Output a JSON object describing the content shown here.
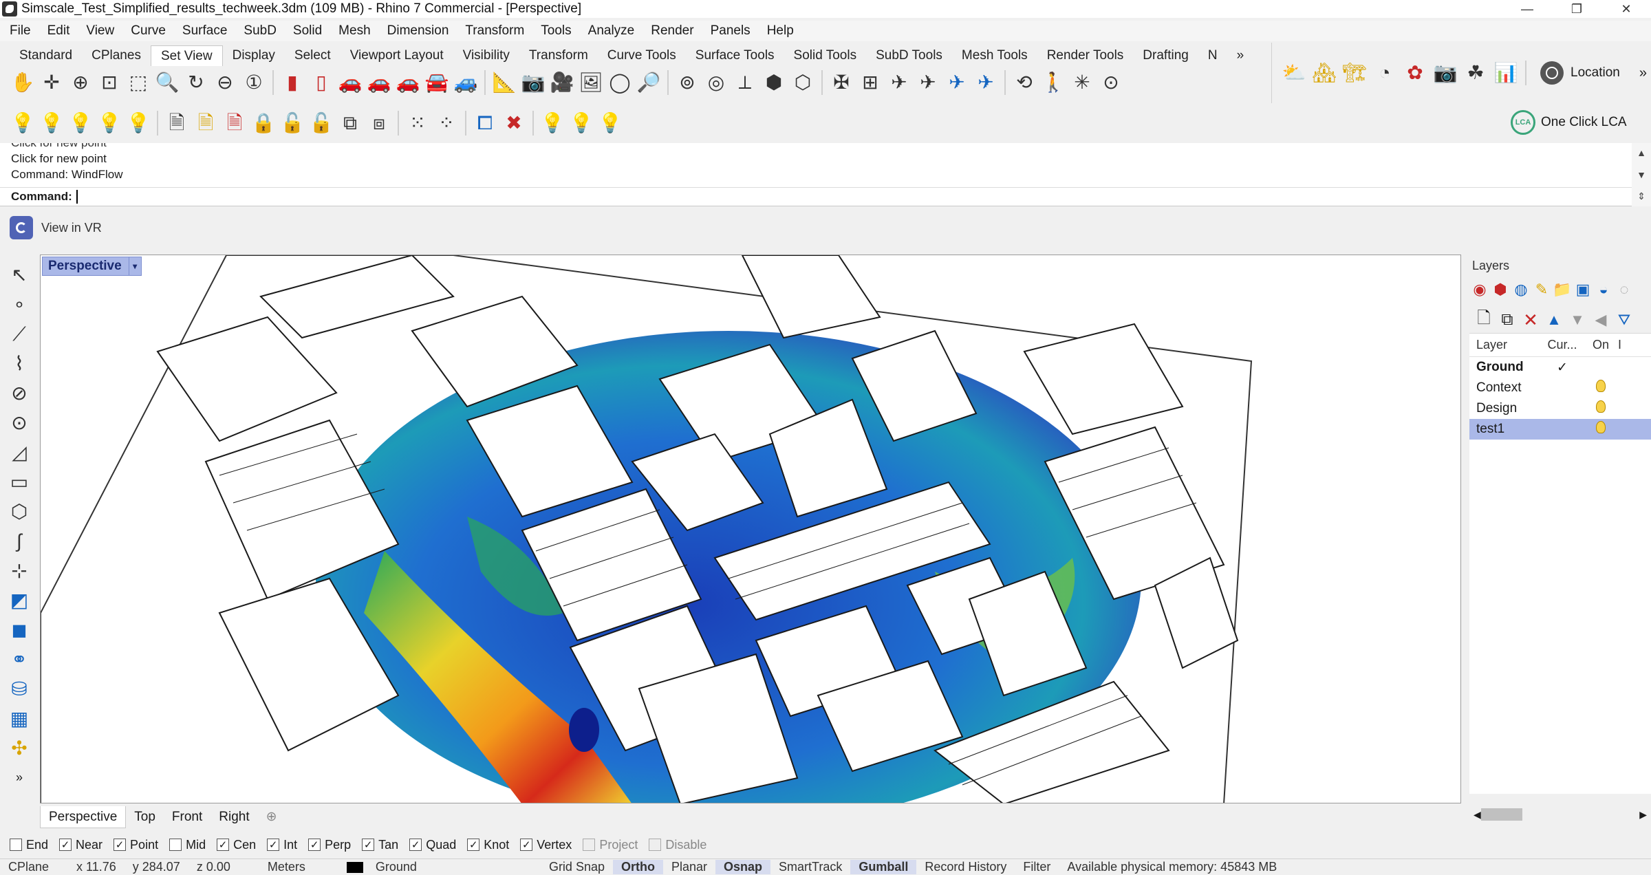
{
  "window": {
    "title": "Simscale_Test_Simplified_results_techweek.3dm (109 MB) - Rhino 7 Commercial - [Perspective]",
    "minimize": "—",
    "restore": "❐",
    "close": "✕"
  },
  "menu": [
    "File",
    "Edit",
    "View",
    "Curve",
    "Surface",
    "SubD",
    "Solid",
    "Mesh",
    "Dimension",
    "Transform",
    "Tools",
    "Analyze",
    "Render",
    "Panels",
    "Help"
  ],
  "tabs": {
    "items": [
      "Standard",
      "CPlanes",
      "Set View",
      "Display",
      "Select",
      "Viewport Layout",
      "Visibility",
      "Transform",
      "Curve Tools",
      "Surface Tools",
      "Solid Tools",
      "SubD Tools",
      "Mesh Tools",
      "Render Tools",
      "Drafting",
      "N"
    ],
    "active": "Set View",
    "overflow": "»"
  },
  "right_toolbar": {
    "location_label": "Location",
    "lca_label": "One Click LCA",
    "lca_badge": "LCA"
  },
  "command": {
    "history": [
      "Click for new point",
      "Click for new point",
      "Command: WindFlow"
    ],
    "prompt": "Command:",
    "input": ""
  },
  "vr": {
    "label": "View in VR"
  },
  "viewport": {
    "name": "Perspective",
    "tabs": [
      "Perspective",
      "Top",
      "Front",
      "Right"
    ],
    "active_tab": "Perspective",
    "add_tab": "⊕"
  },
  "layers": {
    "title": "Layers",
    "columns": [
      "Layer",
      "Cur...",
      "On",
      "I"
    ],
    "rows": [
      {
        "name": "Ground",
        "current": "✓",
        "on": false,
        "bold": true,
        "selected": false
      },
      {
        "name": "Context",
        "current": "",
        "on": true,
        "bold": false,
        "selected": false
      },
      {
        "name": "Design",
        "current": "",
        "on": true,
        "bold": false,
        "selected": false
      },
      {
        "name": "test1",
        "current": "",
        "on": true,
        "bold": false,
        "selected": true
      }
    ]
  },
  "osnap": [
    {
      "label": "End",
      "checked": false,
      "enabled": true
    },
    {
      "label": "Near",
      "checked": true,
      "enabled": true
    },
    {
      "label": "Point",
      "checked": true,
      "enabled": true
    },
    {
      "label": "Mid",
      "checked": false,
      "enabled": true
    },
    {
      "label": "Cen",
      "checked": true,
      "enabled": true
    },
    {
      "label": "Int",
      "checked": true,
      "enabled": true
    },
    {
      "label": "Perp",
      "checked": true,
      "enabled": true
    },
    {
      "label": "Tan",
      "checked": true,
      "enabled": true
    },
    {
      "label": "Quad",
      "checked": true,
      "enabled": true
    },
    {
      "label": "Knot",
      "checked": true,
      "enabled": true
    },
    {
      "label": "Vertex",
      "checked": true,
      "enabled": true
    },
    {
      "label": "Project",
      "checked": false,
      "enabled": false
    },
    {
      "label": "Disable",
      "checked": false,
      "enabled": false
    }
  ],
  "status": {
    "cplane": "CPlane",
    "x": "x 11.76",
    "y": "y 284.07",
    "z": "z 0.00",
    "units": "Meters",
    "layer": "Ground",
    "grid_snap": "Grid Snap",
    "ortho": "Ortho",
    "planar": "Planar",
    "osnap": "Osnap",
    "smarttrack": "SmartTrack",
    "gumball": "Gumball",
    "record_history": "Record History",
    "filter": "Filter",
    "memory": "Available physical memory: 45843 MB"
  },
  "colors": {
    "accent": "#aab8e8",
    "viewport_bg": "#ffffff",
    "wind_low": "#0d2f9c",
    "wind_mid": "#22a85a",
    "wind_high": "#d62a1a"
  }
}
